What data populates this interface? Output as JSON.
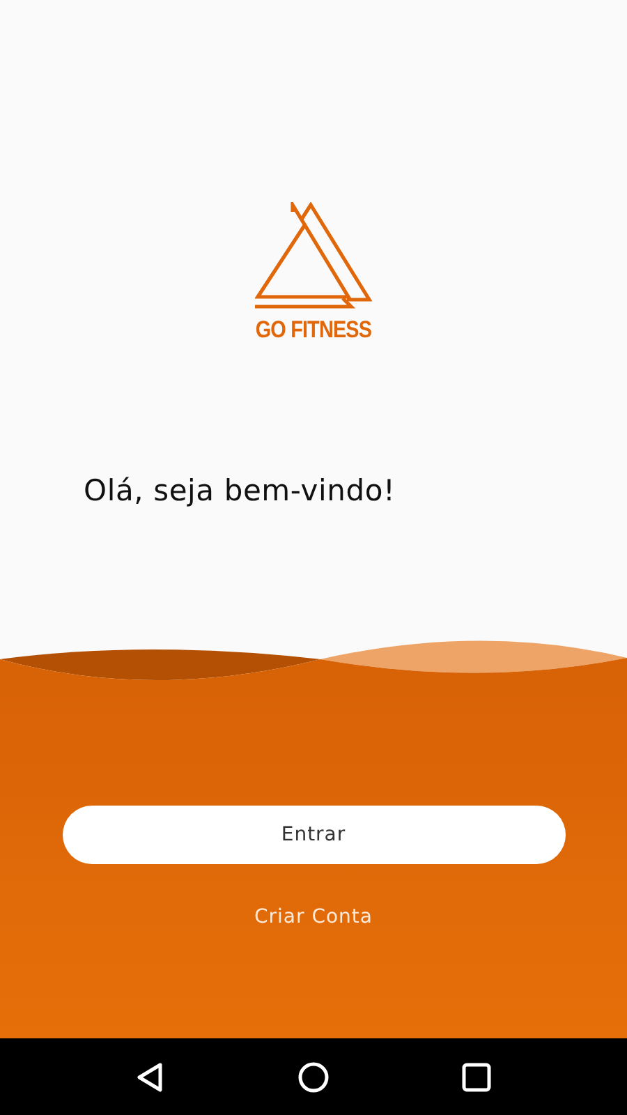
{
  "logo": {
    "brand": "GO FITNESS"
  },
  "greeting": "Olá, seja bem-vindo!",
  "buttons": [
    {
      "label": "Entrar",
      "kind": "primary"
    },
    {
      "label": "Criar Conta",
      "kind": "link"
    }
  ],
  "nav_bar": {
    "buttons": [
      {
        "kind": "back"
      },
      {
        "kind": "home"
      },
      {
        "kind": "recents"
      }
    ]
  }
}
